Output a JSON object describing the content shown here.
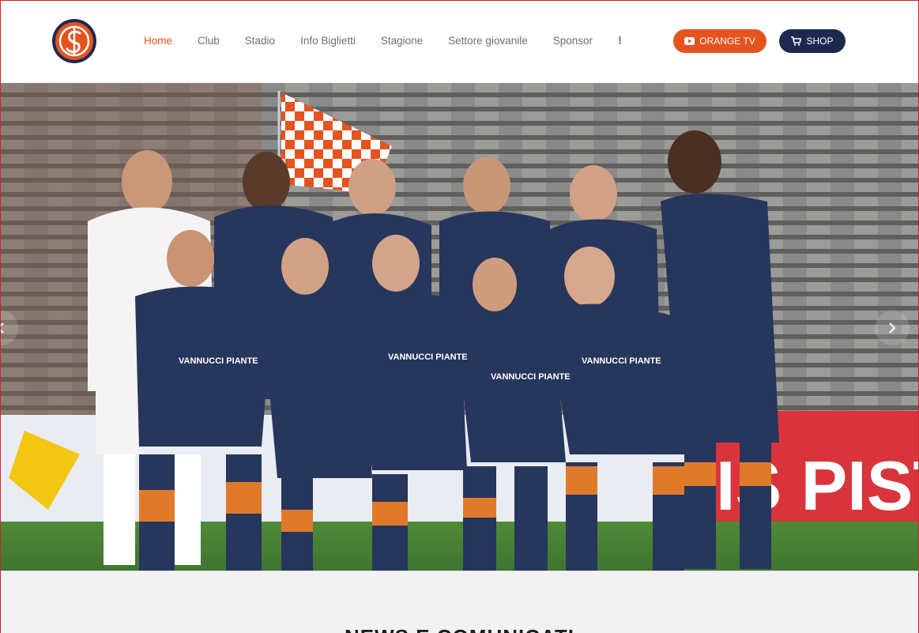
{
  "header": {
    "logo_alt": "US Pistoiese logo",
    "nav": [
      {
        "label": "Home",
        "active": true
      },
      {
        "label": "Club",
        "active": false
      },
      {
        "label": "Stadio",
        "active": false
      },
      {
        "label": "Info Biglietti",
        "active": false
      },
      {
        "label": "Stagione",
        "active": false
      },
      {
        "label": "Settore giovanile",
        "active": false
      },
      {
        "label": "Sponsor",
        "active": false
      }
    ],
    "more_icon": "!",
    "orange_tv_label": "ORANGE TV",
    "orange_tv_icon": "youtube-icon",
    "shop_label": "SHOP",
    "shop_icon": "cart-icon"
  },
  "hero": {
    "image_alt": "Team photo of youth squad in navy and orange kits",
    "jersey_sponsor": "VANNUCCI PIANTE",
    "banner_text": "IS PISTO",
    "prev_icon": "chevron-left-icon",
    "next_icon": "chevron-right-icon"
  },
  "news": {
    "title": "NEWS E COMUNICATI"
  },
  "colors": {
    "accent_orange": "#e5531f",
    "navy": "#1d2a4f",
    "border_red": "#c9252c"
  }
}
